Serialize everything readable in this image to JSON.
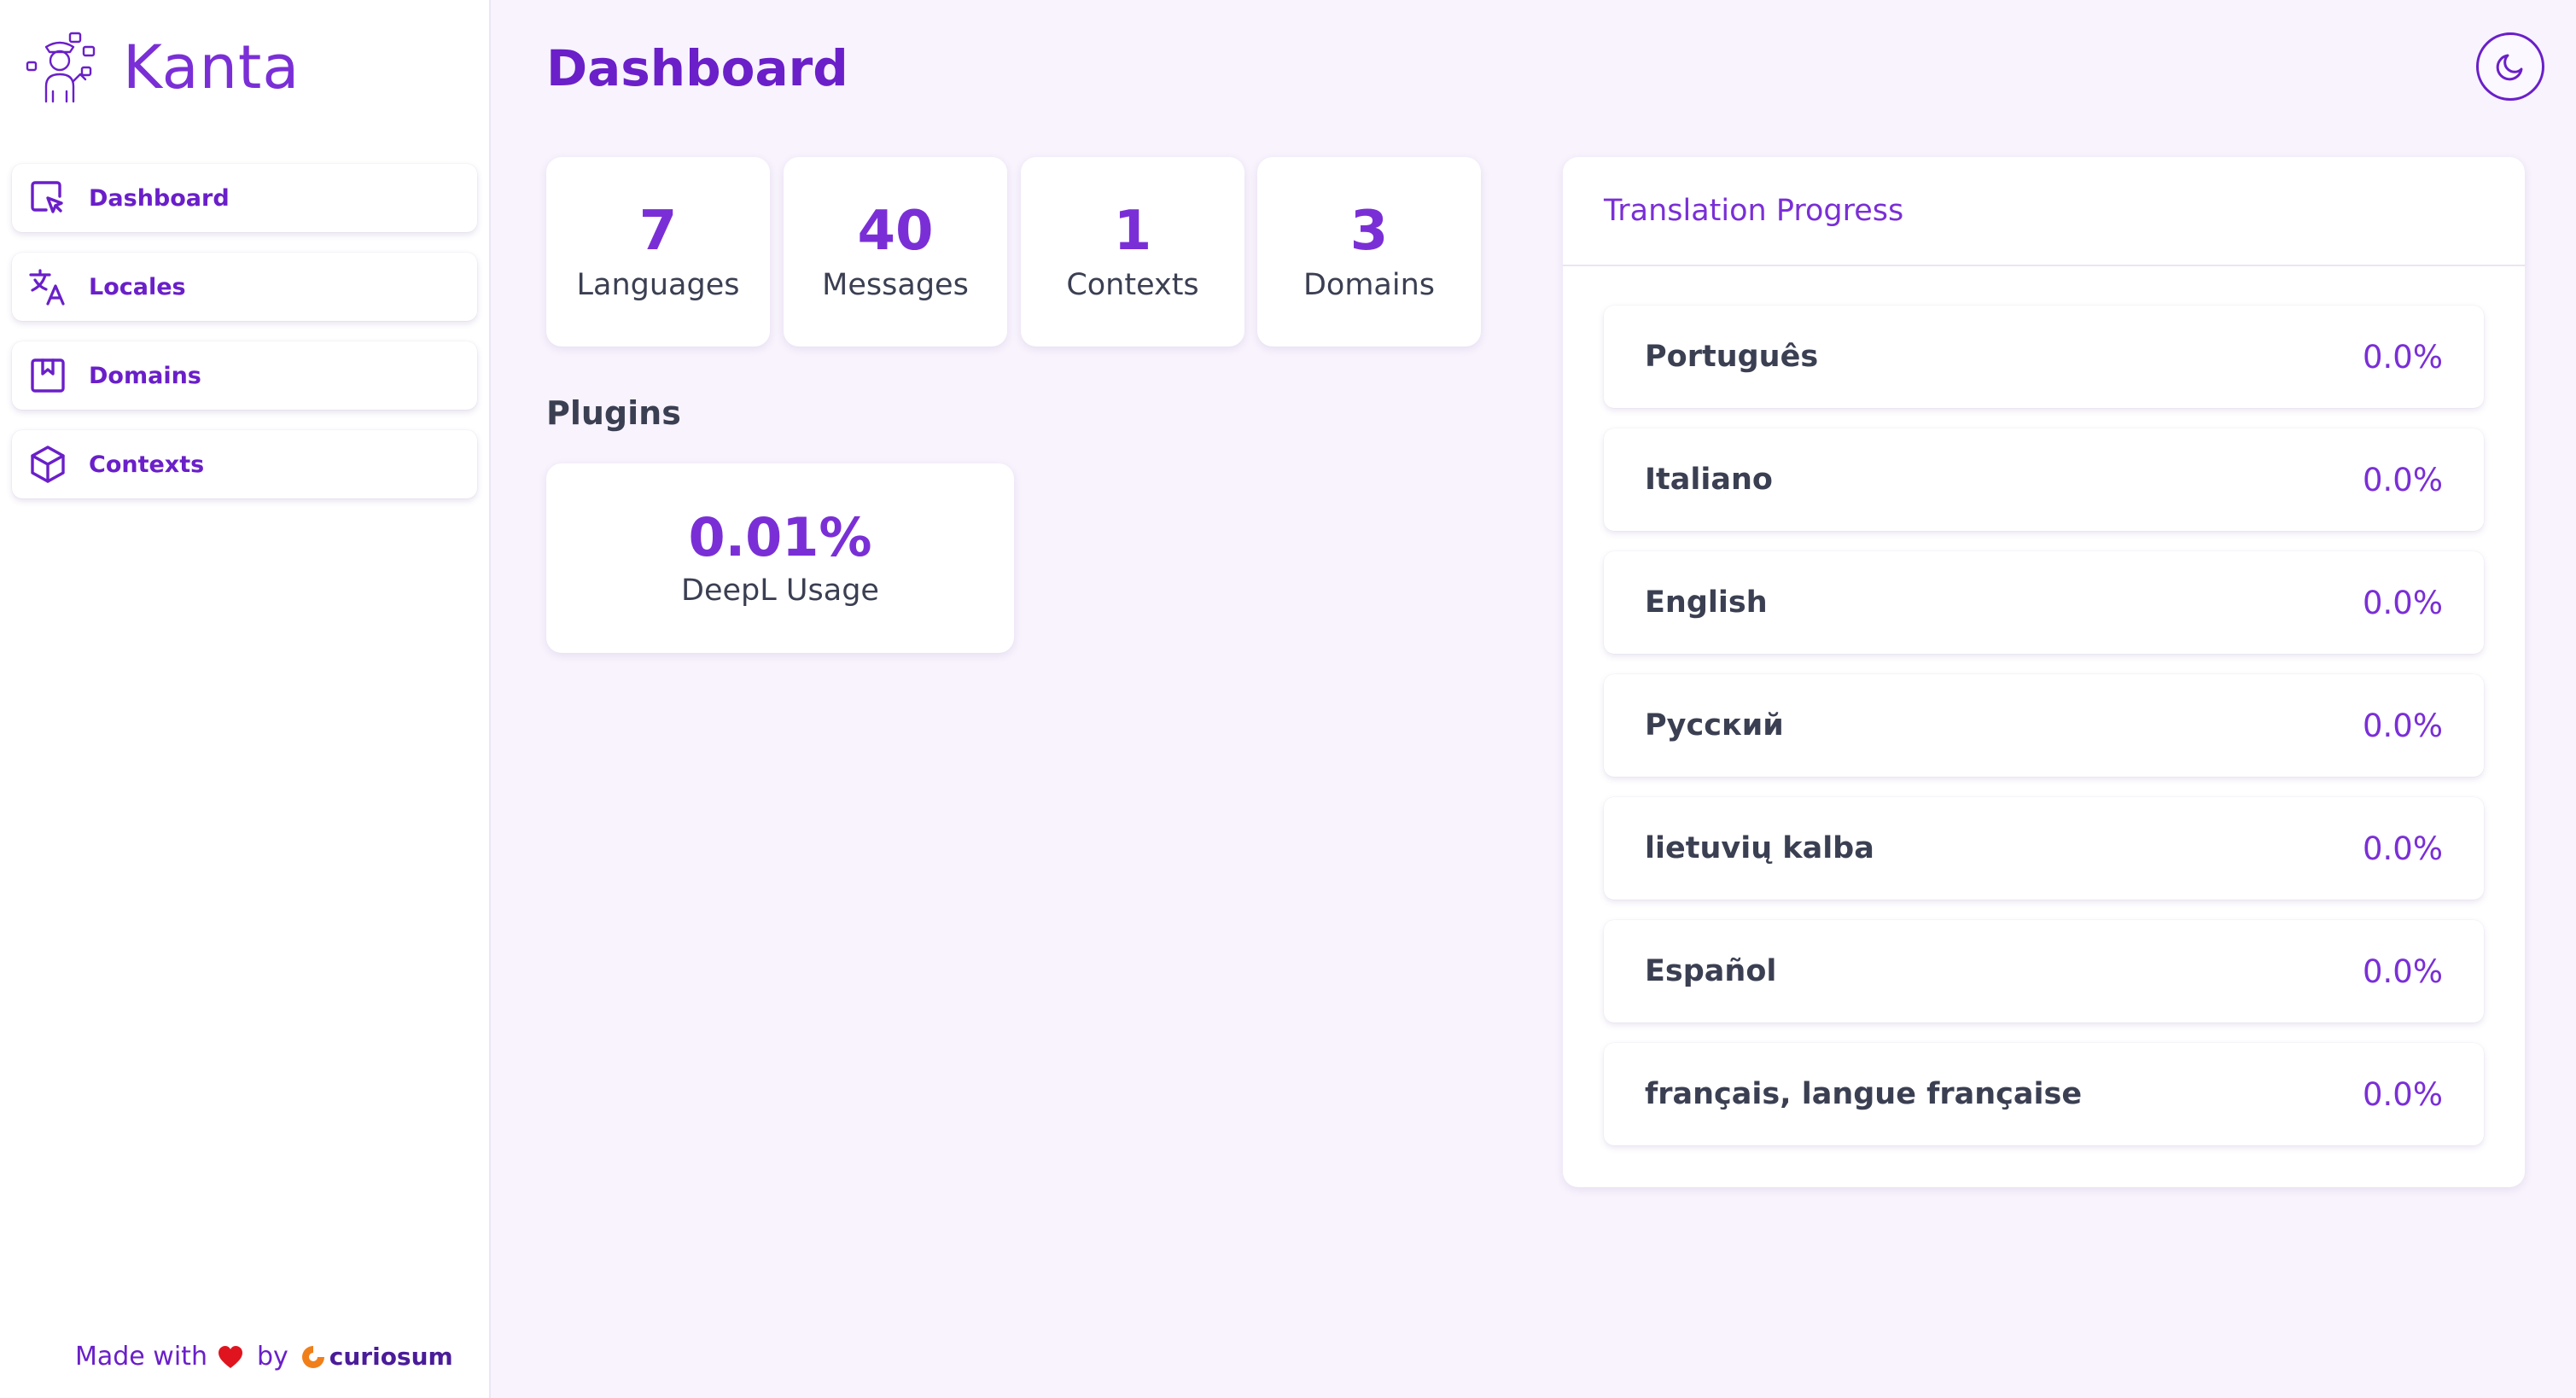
{
  "app": {
    "name": "Kanta"
  },
  "nav": {
    "items": [
      {
        "label": "Dashboard",
        "icon": "dashboard-cursor-icon"
      },
      {
        "label": "Locales",
        "icon": "translate-icon"
      },
      {
        "label": "Domains",
        "icon": "bookmark-icon"
      },
      {
        "label": "Contexts",
        "icon": "cube-icon"
      }
    ]
  },
  "footer": {
    "made_with": "Made with",
    "by": "by",
    "brand": "curiosum"
  },
  "page": {
    "title": "Dashboard"
  },
  "stats": [
    {
      "value": "7",
      "label": "Languages"
    },
    {
      "value": "40",
      "label": "Messages"
    },
    {
      "value": "1",
      "label": "Contexts"
    },
    {
      "value": "3",
      "label": "Domains"
    }
  ],
  "plugins": {
    "title": "Plugins",
    "deepl": {
      "value": "0.01%",
      "label": "DeepL Usage"
    }
  },
  "progress": {
    "title": "Translation Progress",
    "locales": [
      {
        "name": "Português",
        "percent": "0.0%"
      },
      {
        "name": "Italiano",
        "percent": "0.0%"
      },
      {
        "name": "English",
        "percent": "0.0%"
      },
      {
        "name": "Русский",
        "percent": "0.0%"
      },
      {
        "name": "lietuvių kalba",
        "percent": "0.0%"
      },
      {
        "name": "Español",
        "percent": "0.0%"
      },
      {
        "name": "français, langue française",
        "percent": "0.0%"
      }
    ]
  },
  "colors": {
    "accent": "#6a1fc9",
    "accent_light": "#7a2fd6",
    "background": "#f8f3fd",
    "heart": "#e0141e",
    "curiosum_orange": "#f07f1a"
  }
}
